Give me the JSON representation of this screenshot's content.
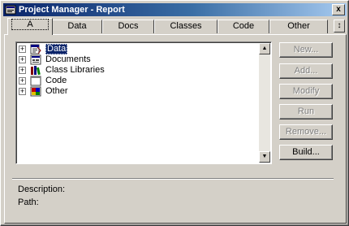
{
  "window": {
    "title": "Project Manager - Report",
    "close_glyph": "x"
  },
  "tabs": [
    {
      "label": "A",
      "active": true
    },
    {
      "label": "Data",
      "active": false
    },
    {
      "label": "Docs",
      "active": false
    },
    {
      "label": "Classes",
      "active": false
    },
    {
      "label": "Code",
      "active": false
    },
    {
      "label": "Other",
      "active": false
    }
  ],
  "tab_scroll_glyph": "↕",
  "tree": {
    "items": [
      {
        "label": "Data",
        "icon": "data-icon",
        "expander": "+"
      },
      {
        "label": "Documents",
        "icon": "documents-icon",
        "expander": "+"
      },
      {
        "label": "Class Libraries",
        "icon": "class-libraries-icon",
        "expander": "+"
      },
      {
        "label": "Code",
        "icon": "code-icon",
        "expander": "+"
      },
      {
        "label": "Other",
        "icon": "other-icon",
        "expander": "+"
      }
    ]
  },
  "buttons": [
    {
      "label": "New...",
      "enabled": false
    },
    {
      "label": "Add...",
      "enabled": false
    },
    {
      "label": "Modify",
      "enabled": false
    },
    {
      "label": "Run",
      "enabled": false
    },
    {
      "label": "Remove...",
      "enabled": false
    },
    {
      "label": "Build...",
      "enabled": true
    }
  ],
  "info": {
    "description_label": "Description:",
    "path_label": "Path:"
  },
  "colors": {
    "title_start": "#0a246a",
    "title_end": "#a6caf0",
    "selection": "#0a246a",
    "face": "#d4d0c8"
  }
}
